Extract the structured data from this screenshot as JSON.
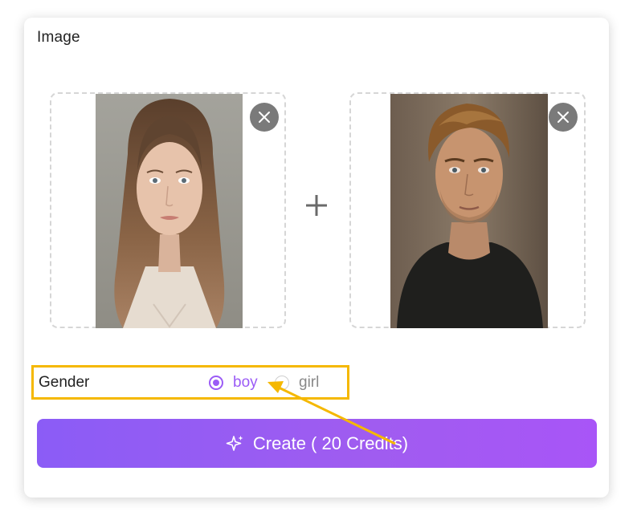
{
  "section": {
    "label": "Image"
  },
  "images": [
    {
      "alt": "woman portrait",
      "remove_icon": "close-icon"
    },
    {
      "alt": "man portrait",
      "remove_icon": "close-icon"
    }
  ],
  "combine_icon": "plus-icon",
  "gender": {
    "label": "Gender",
    "options": [
      {
        "label": "boy",
        "selected": true
      },
      {
        "label": "girl",
        "selected": false
      }
    ]
  },
  "create_button": {
    "icon": "sparkle-icon",
    "label": "Create ( 20 Credits)"
  },
  "colors": {
    "accent": "#9b5cf6",
    "button_gradient_start": "#8b5cf6",
    "button_gradient_end": "#a855f7",
    "highlight_box": "#f5b800",
    "annotation_arrow": "#f5b800"
  }
}
